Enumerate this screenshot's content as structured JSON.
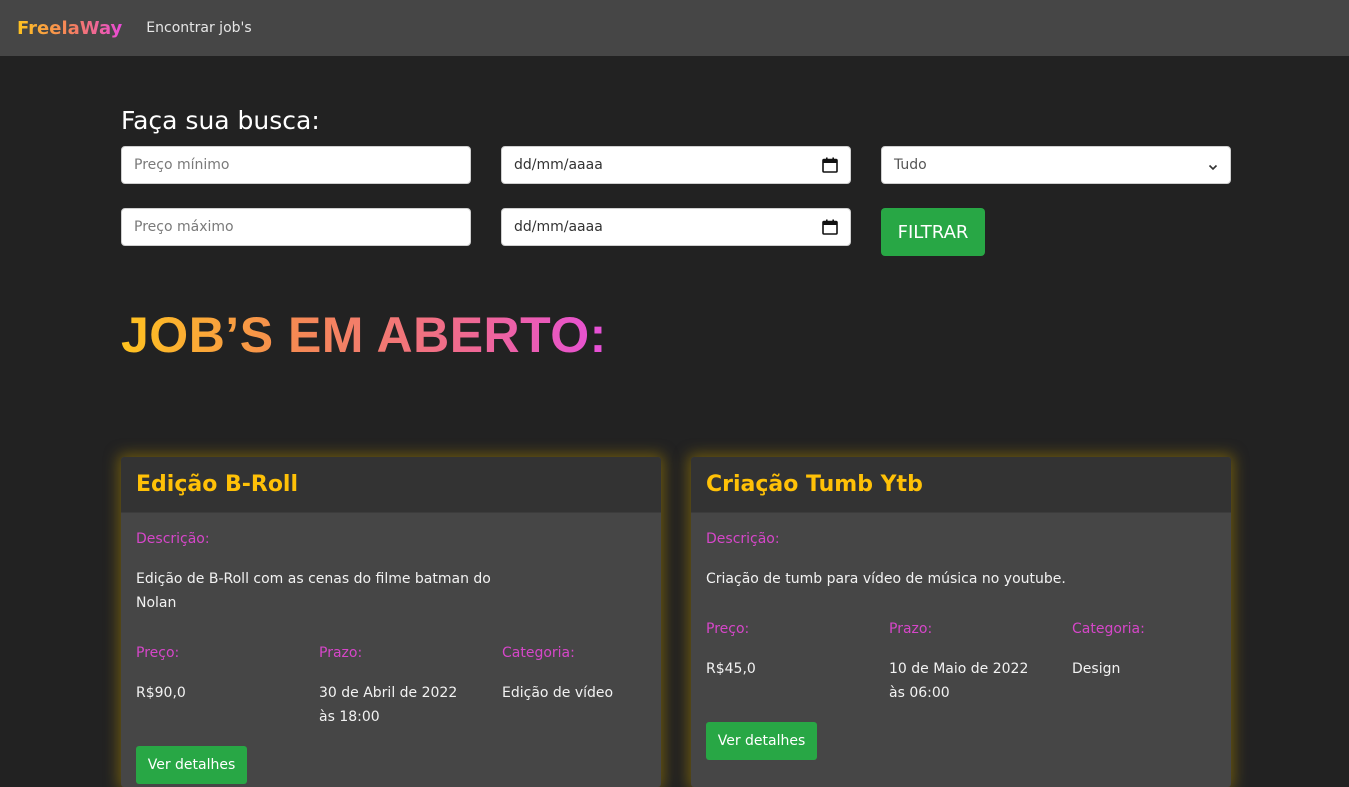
{
  "navbar": {
    "brand": "FreelaWay",
    "links": [
      {
        "label": "Encontrar job's"
      }
    ]
  },
  "search": {
    "title": "Faça sua busca:",
    "min_price_placeholder": "Preço mínimo",
    "max_price_placeholder": "Preço máximo",
    "date_from_value": "dd/mm/aaaa",
    "date_to_value": "dd/mm/aaaa",
    "category_selected": "Tudo",
    "filter_label": "FILTRAR"
  },
  "jobs": {
    "title": "JOB’S EM ABERTO:",
    "cards": [
      {
        "title": "Edição B-Roll",
        "description_label": "Descrição:",
        "description": "Edição de B-Roll com as cenas do filme batman do Nolan",
        "price_label": "Preço:",
        "price": "R$90,0",
        "deadline_label": "Prazo:",
        "deadline": "30 de Abril de 2022 às 18:00",
        "category_label": "Categoria:",
        "category": "Edição de vídeo",
        "details_label": "Ver detalhes"
      },
      {
        "title": "Criação Tumb Ytb",
        "description_label": "Descrição:",
        "description": "Criação de tumb para vídeo de música no youtube.",
        "price_label": "Preço:",
        "price": "R$45,0",
        "deadline_label": "Prazo:",
        "deadline": "10 de Maio de 2022 às 06:00",
        "category_label": "Categoria:",
        "category": "Design",
        "details_label": "Ver detalhes"
      }
    ]
  },
  "colors": {
    "background": "#222222",
    "navbar": "#464646",
    "accent_yellow": "#ffc107",
    "accent_pink": "#d646c9",
    "button_green": "#28a745"
  },
  "icons": [
    "calendar-icon",
    "chevron-down-icon"
  ]
}
